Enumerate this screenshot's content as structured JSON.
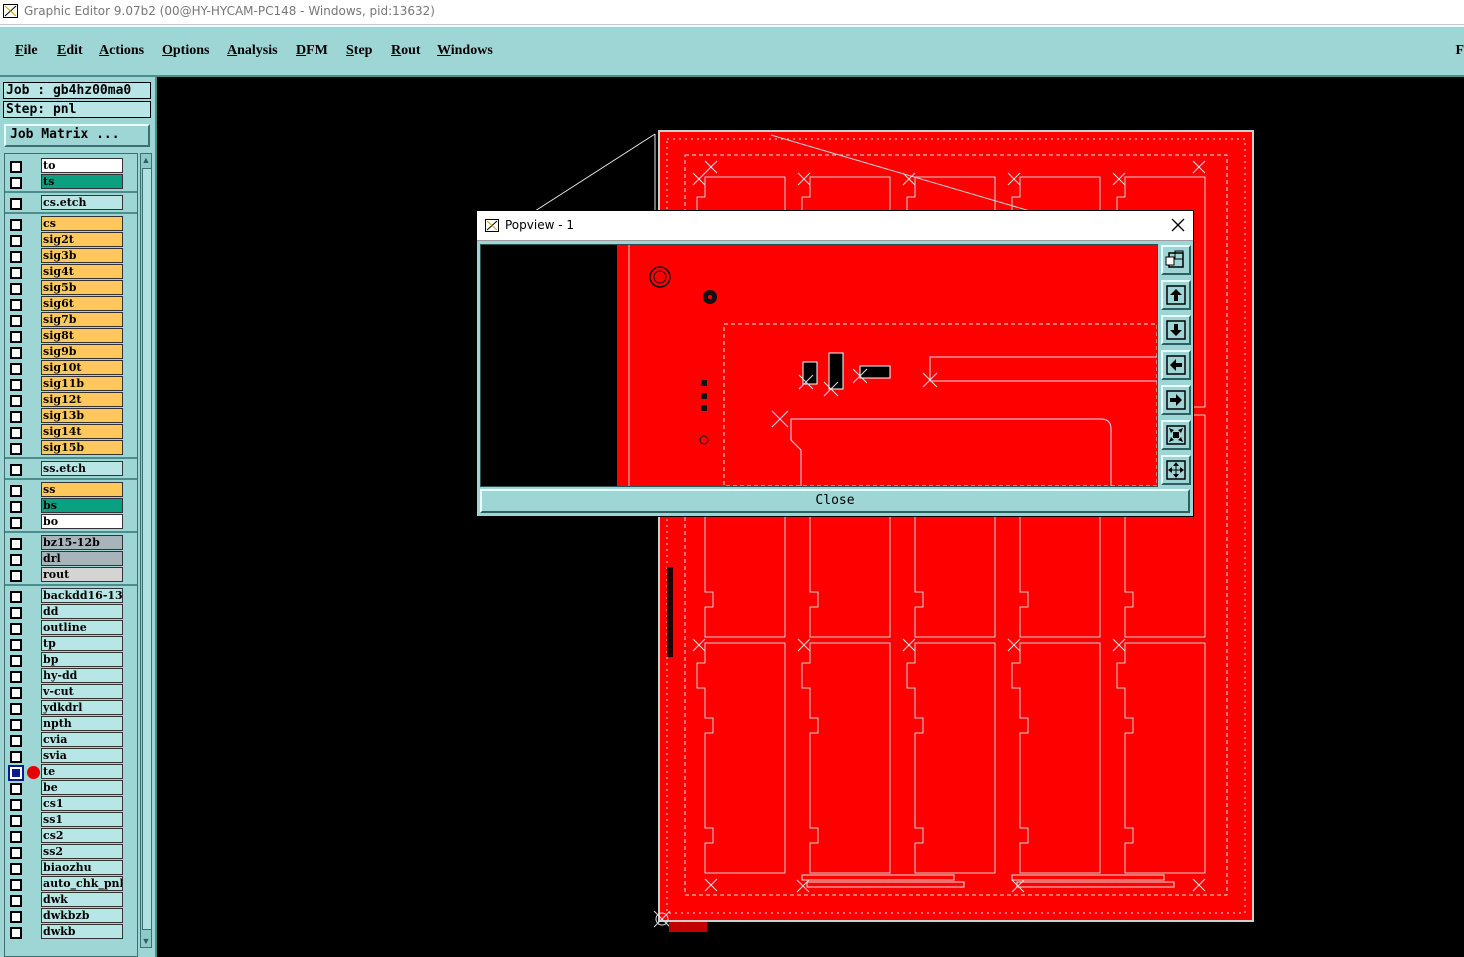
{
  "window": {
    "title": "Graphic Editor 9.07b2 (00@HY-HYCAM-PC148 - Windows, pid:13632)"
  },
  "menu": {
    "items": [
      "File",
      "Edit",
      "Actions",
      "Options",
      "Analysis",
      "DFM",
      "Step",
      "Rout",
      "Windows"
    ],
    "overflow_label": "F"
  },
  "job": {
    "job_line": "Job : gb4hz00ma0",
    "step_line": "Step: pnl",
    "matrix_button": "Job Matrix ..."
  },
  "layers": [
    {
      "name": "to",
      "color": "#ffffff",
      "group": 1
    },
    {
      "name": "ts",
      "color": "#0aa080",
      "group": 1
    },
    {
      "name": "cs.etch",
      "color": "#b8e6e6",
      "group": 2
    },
    {
      "name": "cs",
      "color": "#ffc85a",
      "group": 3
    },
    {
      "name": "sig2t",
      "color": "#ffc85a",
      "group": 3
    },
    {
      "name": "sig3b",
      "color": "#ffc85a",
      "group": 3
    },
    {
      "name": "sig4t",
      "color": "#ffc85a",
      "group": 3
    },
    {
      "name": "sig5b",
      "color": "#ffc85a",
      "group": 3
    },
    {
      "name": "sig6t",
      "color": "#ffc85a",
      "group": 3
    },
    {
      "name": "sig7b",
      "color": "#ffc85a",
      "group": 3
    },
    {
      "name": "sig8t",
      "color": "#ffc85a",
      "group": 3
    },
    {
      "name": "sig9b",
      "color": "#ffc85a",
      "group": 3
    },
    {
      "name": "sig10t",
      "color": "#ffc85a",
      "group": 3
    },
    {
      "name": "sig11b",
      "color": "#ffc85a",
      "group": 3
    },
    {
      "name": "sig12t",
      "color": "#ffc85a",
      "group": 3
    },
    {
      "name": "sig13b",
      "color": "#ffc85a",
      "group": 3
    },
    {
      "name": "sig14t",
      "color": "#ffc85a",
      "group": 3
    },
    {
      "name": "sig15b",
      "color": "#ffc85a",
      "group": 3
    },
    {
      "name": "ss.etch",
      "color": "#b8e6e6",
      "group": 4
    },
    {
      "name": "ss",
      "color": "#ffc85a",
      "group": 5
    },
    {
      "name": "bs",
      "color": "#0aa080",
      "group": 5
    },
    {
      "name": "bo",
      "color": "#ffffff",
      "group": 5
    },
    {
      "name": "bz15-12b",
      "color": "#a8b4bc",
      "group": 6
    },
    {
      "name": "drl",
      "color": "#a8b4bc",
      "group": 6
    },
    {
      "name": "rout",
      "color": "#d4d4d4",
      "group": 6
    },
    {
      "name": "backdd16-13",
      "color": "#b8e6e6",
      "group": 7
    },
    {
      "name": "dd",
      "color": "#b8e6e6",
      "group": 7
    },
    {
      "name": "outline",
      "color": "#b8e6e6",
      "group": 7
    },
    {
      "name": "tp",
      "color": "#b8e6e6",
      "group": 7
    },
    {
      "name": "bp",
      "color": "#b8e6e6",
      "group": 7
    },
    {
      "name": "hy-dd",
      "color": "#b8e6e6",
      "group": 7
    },
    {
      "name": "v-cut",
      "color": "#b8e6e6",
      "group": 7
    },
    {
      "name": "ydkdrl",
      "color": "#b8e6e6",
      "group": 7
    },
    {
      "name": "npth",
      "color": "#b8e6e6",
      "group": 7
    },
    {
      "name": "cvia",
      "color": "#b8e6e6",
      "group": 7
    },
    {
      "name": "svia",
      "color": "#b8e6e6",
      "group": 7
    },
    {
      "name": "te",
      "color": "#b8e6e6",
      "group": 7,
      "active": true
    },
    {
      "name": "be",
      "color": "#b8e6e6",
      "group": 7
    },
    {
      "name": "cs1",
      "color": "#b8e6e6",
      "group": 7
    },
    {
      "name": "ss1",
      "color": "#b8e6e6",
      "group": 7
    },
    {
      "name": "cs2",
      "color": "#b8e6e6",
      "group": 7
    },
    {
      "name": "ss2",
      "color": "#b8e6e6",
      "group": 7
    },
    {
      "name": "biaozhu",
      "color": "#b8e6e6",
      "group": 7
    },
    {
      "name": "auto_chk_pnl",
      "color": "#b8e6e6",
      "group": 7
    },
    {
      "name": "dwk",
      "color": "#b8e6e6",
      "group": 7
    },
    {
      "name": "dwkbzb",
      "color": "#b8e6e6",
      "group": 7
    },
    {
      "name": "dwkb",
      "color": "#b8e6e6",
      "group": 7
    }
  ],
  "popview": {
    "title": "Popview - 1",
    "close_label": "Close",
    "tools": [
      "zoom-window-icon",
      "pan-up-icon",
      "pan-down-icon",
      "pan-left-icon",
      "pan-right-icon",
      "zoom-fit-icon",
      "zoom-home-icon"
    ]
  },
  "colors": {
    "board": "#ff0000",
    "panel": "#9ed6d6",
    "canvas": "#000000",
    "outline": "#c8d0d0"
  }
}
